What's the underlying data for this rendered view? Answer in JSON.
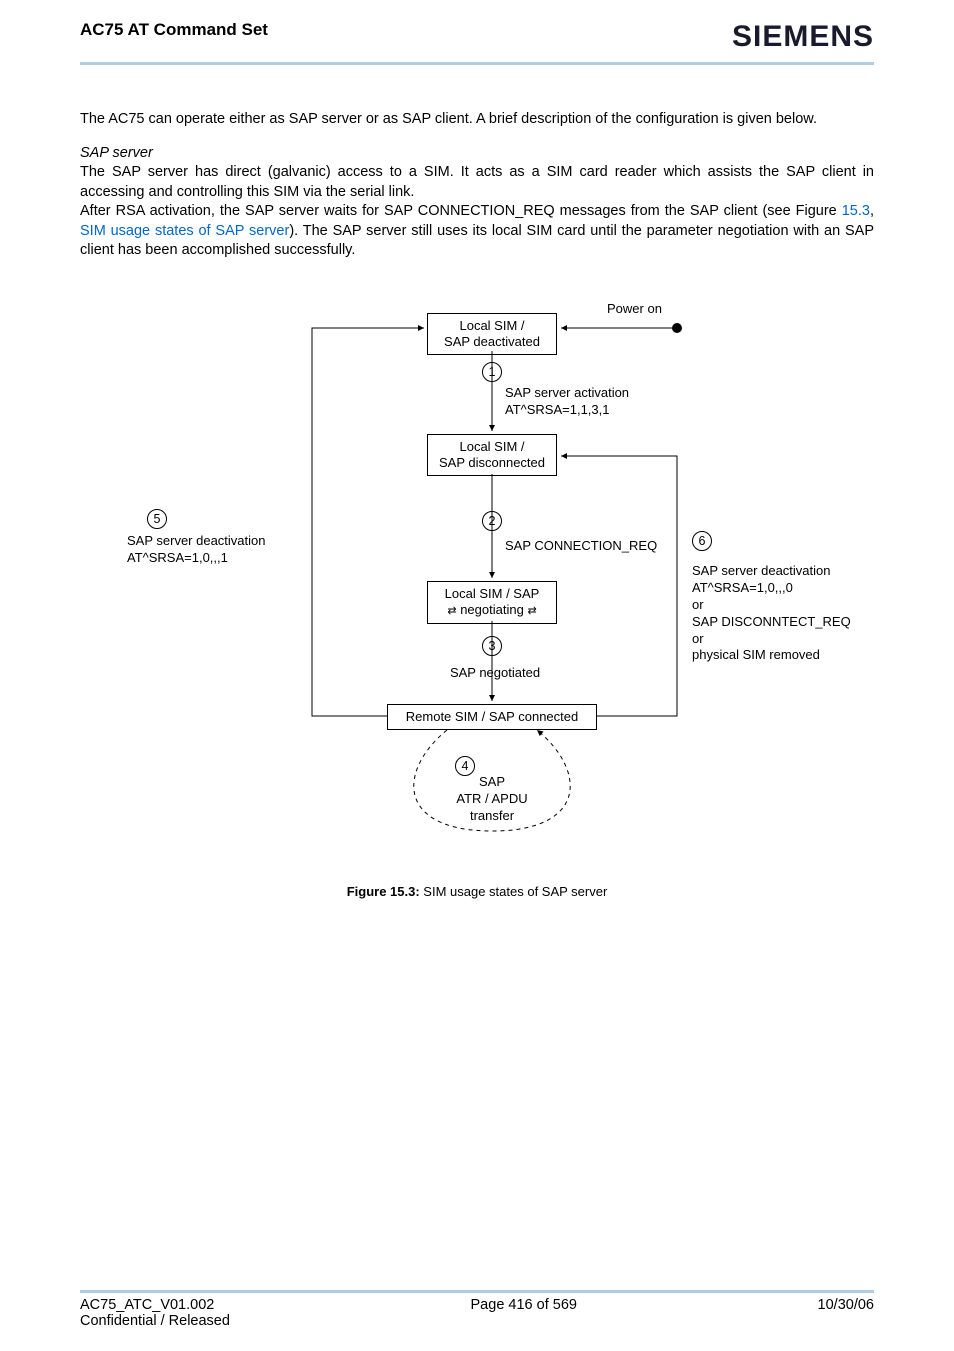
{
  "header": {
    "doc_title": "AC75 AT Command Set",
    "brand": "SIEMENS"
  },
  "body": {
    "p1": "The AC75 can operate either as SAP server or as SAP client. A brief description of the configuration is given below.",
    "sap_server_label": "SAP server",
    "p2": "The SAP server has direct (galvanic) access to a SIM. It acts as a SIM card reader which assists the SAP client in accessing and controlling this SIM via the serial link.",
    "p3a": "After RSA activation, the SAP server waits for SAP CONNECTION_REQ messages from the SAP client (see Figure ",
    "p3_link1": "15.3",
    "p3_sep": ", ",
    "p3_link2": "SIM usage states of SAP server",
    "p3b": "). The SAP server still uses its local SIM card until the parameter negotiation with an SAP client has been accomplished successfully."
  },
  "diagram": {
    "power_on": "Power on",
    "box1_l1": "Local SIM /",
    "box1_l2": "SAP deactivated",
    "step1_num": "1",
    "step1_l1": "SAP server activation",
    "step1_l2": "AT^SRSA=1,1,3,1",
    "box2_l1": "Local SIM /",
    "box2_l2": "SAP disconnected",
    "step5_num": "5",
    "step5_l1": "SAP server deactivation",
    "step5_l2": "AT^SRSA=1,0,,,1",
    "step2_num": "2",
    "step2_txt": "SAP CONNECTION_REQ",
    "step6_num": "6",
    "step6_l1": "SAP server deactivation",
    "step6_l2": "AT^SRSA=1,0,,,0",
    "step6_l3": "or",
    "step6_l4": "SAP DISCONNTECT_REQ",
    "step6_l5": "or",
    "step6_l6": "physical SIM removed",
    "box3_l1": "Local SIM / SAP",
    "box3_l2": "negotiating",
    "step3_num": "3",
    "step3_txt": "SAP negotiated",
    "box4": "Remote SIM / SAP connected",
    "step4_num": "4",
    "step4_l1": "SAP",
    "step4_l2": "ATR / APDU",
    "step4_l3": "transfer",
    "neg_sym": "⇌"
  },
  "caption": {
    "label": "Figure 15.3:",
    "text": " SIM usage states of SAP server"
  },
  "footer": {
    "version": "AC75_ATC_V01.002",
    "page": "Page 416 of 569",
    "date": "10/30/06",
    "conf": "Confidential / Released"
  }
}
